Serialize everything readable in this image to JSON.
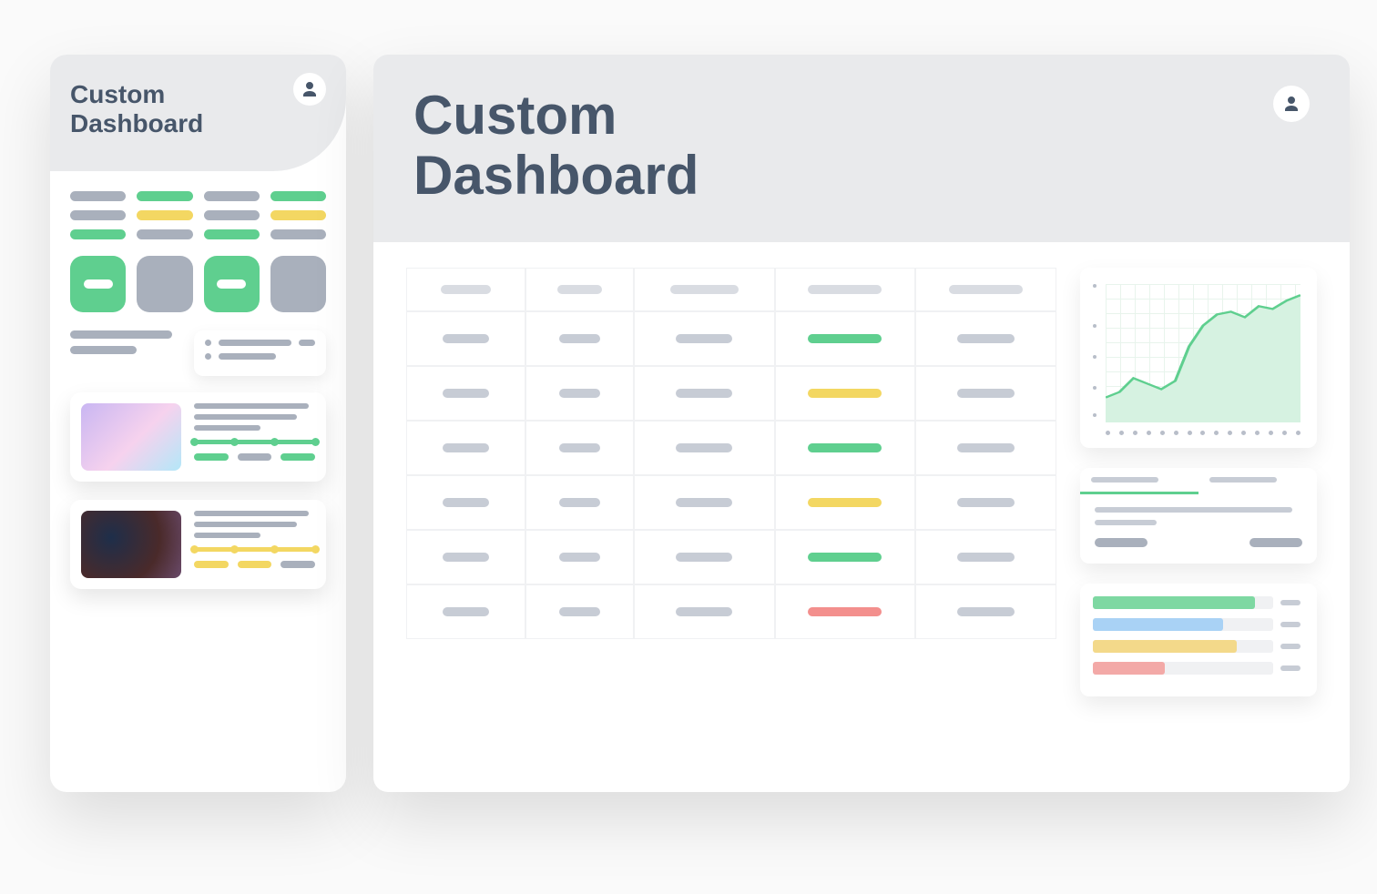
{
  "mobile": {
    "title": "Custom\nDashboard",
    "chips": [
      "g",
      "gr",
      "g",
      "gr",
      "g",
      "y",
      "g",
      "y",
      "gr",
      "g",
      "gr",
      "g"
    ],
    "tiles": [
      true,
      false,
      true,
      false
    ],
    "media": [
      {
        "thumb": "a",
        "progress_color": "#5fcf8f",
        "stops": [
          0,
          33,
          66,
          100
        ],
        "pills": [
          "#5fcf8f",
          "#a9b0bc",
          "#5fcf8f"
        ]
      },
      {
        "thumb": "b",
        "progress_color": "#f3d762",
        "stops": [
          0,
          33,
          66,
          100
        ],
        "pills": [
          "#f3d762",
          "#f3d762",
          "#a9b0bc"
        ]
      }
    ]
  },
  "desktop": {
    "title": "Custom\nDashboard",
    "table": {
      "rows": [
        [
          "g",
          "g",
          "g",
          "gr",
          "g"
        ],
        [
          "g",
          "g",
          "g",
          "y",
          "g"
        ],
        [
          "g",
          "g",
          "g",
          "gr",
          "g"
        ],
        [
          "g",
          "g",
          "g",
          "y",
          "g"
        ],
        [
          "g",
          "g",
          "g",
          "gr",
          "g"
        ],
        [
          "g",
          "g",
          "g",
          "rd",
          "g"
        ]
      ]
    },
    "tabs": {
      "active": 0,
      "count": 2
    }
  },
  "chart_data": {
    "type": "area",
    "x": [
      0,
      1,
      2,
      3,
      4,
      5,
      6,
      7,
      8,
      9,
      10,
      11,
      12,
      13,
      14
    ],
    "y": [
      18,
      22,
      32,
      28,
      24,
      30,
      55,
      70,
      78,
      80,
      76,
      84,
      82,
      88,
      92
    ],
    "ylim": [
      0,
      100
    ],
    "line_color": "#5fcf8f",
    "fill_color": "#d6f2e1",
    "bars": {
      "type": "bar-horizontal",
      "series": [
        {
          "color": "gr",
          "value": 90
        },
        {
          "color": "bl",
          "value": 72
        },
        {
          "color": "yl",
          "value": 80
        },
        {
          "color": "rd",
          "value": 40
        }
      ],
      "xlim": [
        0,
        100
      ]
    }
  }
}
